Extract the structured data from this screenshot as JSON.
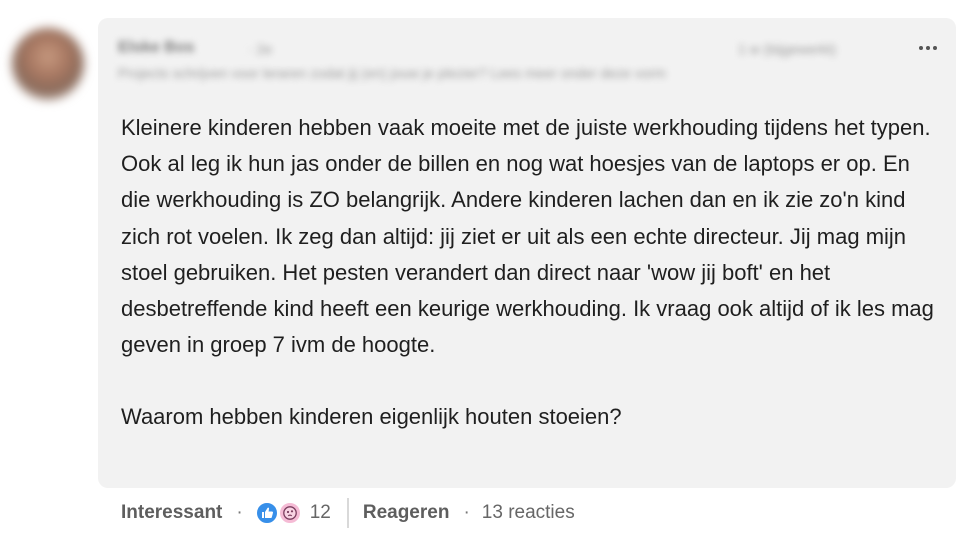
{
  "post": {
    "author_name": "Elske Bos",
    "author_degree": "· 2e",
    "author_headline": "Projects schrijven voor leraren zodat jij (en) jouw je plezier? Lees meer onder deze vorm",
    "timestamp": "1 w (bijgewerkt)",
    "paragraph_1": "Kleinere kinderen hebben vaak moeite met de juiste werkhouding tijdens het typen. Ook al leg ik hun jas onder de billen en nog wat hoesjes van de laptops er op. En die werkhouding is ZO belangrijk. Andere kinderen lachen dan en ik zie zo'n kind zich rot voelen. Ik zeg dan altijd: jij ziet er uit als een echte directeur. Jij mag mijn stoel gebruiken. Het pesten verandert dan direct naar 'wow jij boft' en het desbetreffende kind heeft een keurige werkhouding. Ik vraag ook altijd of ik les mag geven in groep 7 ivm de hoogte.",
    "paragraph_2": "Waarom hebben kinderen eigenlijk houten stoeien?"
  },
  "actions": {
    "reaction_label": "Interessant",
    "separator": "·",
    "reaction_icons": [
      "like-icon",
      "curious-icon"
    ],
    "reaction_count": "12",
    "reply_label": "Reageren",
    "replies_count": "13 reacties"
  },
  "colors": {
    "bubble_bg": "#f2f2f2",
    "like_blue": "#378fe9",
    "curious_pink": "#f5bbd5"
  }
}
